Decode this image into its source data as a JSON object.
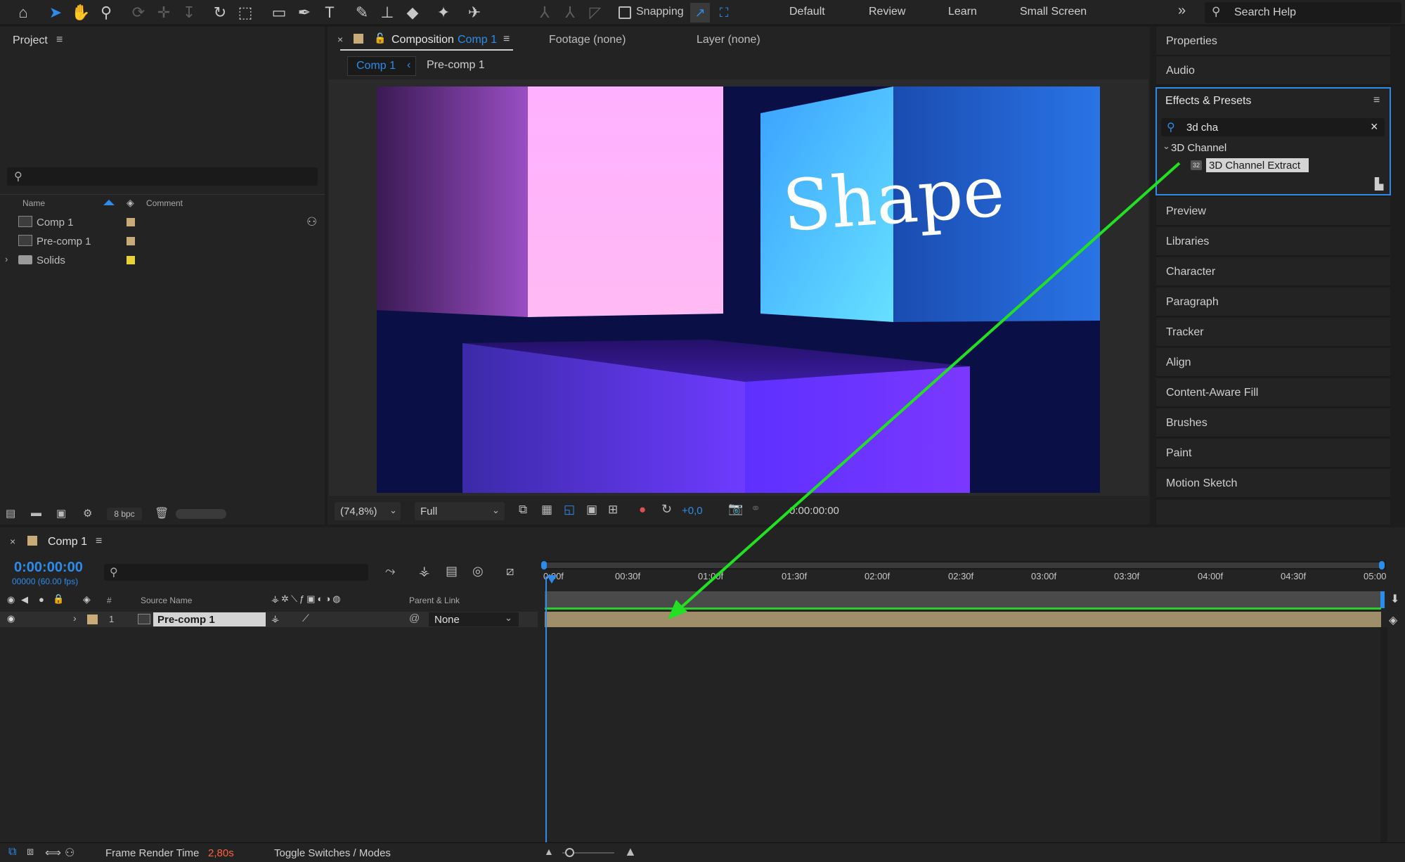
{
  "toolbar": {
    "snapping_label": "Snapping",
    "workspaces": [
      "Default",
      "Review",
      "Learn",
      "Small Screen"
    ],
    "search_placeholder": "Search Help"
  },
  "project": {
    "title": "Project",
    "col_name": "Name",
    "col_comment": "Comment",
    "items": [
      {
        "name": "Comp 1",
        "color": "#c8ab78"
      },
      {
        "name": "Pre-comp 1",
        "color": "#c8ab78"
      },
      {
        "name": "Solids",
        "color": "#e8d23a"
      }
    ],
    "bpc": "8 bpc"
  },
  "composition": {
    "tab_prefix": "Composition",
    "tab_name": "Comp 1",
    "footage_tab": "Footage (none)",
    "layer_tab": "Layer (none)",
    "breadcrumb": [
      "Comp 1",
      "Pre-comp 1"
    ],
    "viewer_text": "Shape",
    "zoom": "(74,8%)",
    "resolution": "Full",
    "exposure": "+0,0",
    "timecode": "0:00:00:00"
  },
  "right_panel": {
    "properties": "Properties",
    "audio": "Audio",
    "effects_title": "Effects & Presets",
    "search_value": "3d cha",
    "category": "3D Channel",
    "effect": "3D Channel Extract",
    "panels": [
      "Preview",
      "Libraries",
      "Character",
      "Paragraph",
      "Tracker",
      "Align",
      "Content-Aware Fill",
      "Brushes",
      "Paint",
      "Motion Sketch"
    ]
  },
  "timeline": {
    "comp_name": "Comp 1",
    "timecode": "0:00:00:00",
    "fps": "00000 (60.00 fps)",
    "col_num": "#",
    "col_source": "Source Name",
    "col_parent": "Parent & Link",
    "layer_num": "1",
    "layer_name": "Pre-comp 1",
    "parent_value": "None",
    "ruler_labels": [
      "0:00f",
      "00:30f",
      "01:00f",
      "01:30f",
      "02:00f",
      "02:30f",
      "03:00f",
      "03:30f",
      "04:00f",
      "04:30f",
      "05:00"
    ]
  },
  "status": {
    "frame_render_label": "Frame Render Time",
    "frame_render_value": "2,80s",
    "toggle_label": "Toggle Switches / Modes"
  },
  "colors": {
    "accent_blue": "#2d8ceb",
    "annotation_green": "#22e022",
    "label_tan": "#c8ab78"
  }
}
